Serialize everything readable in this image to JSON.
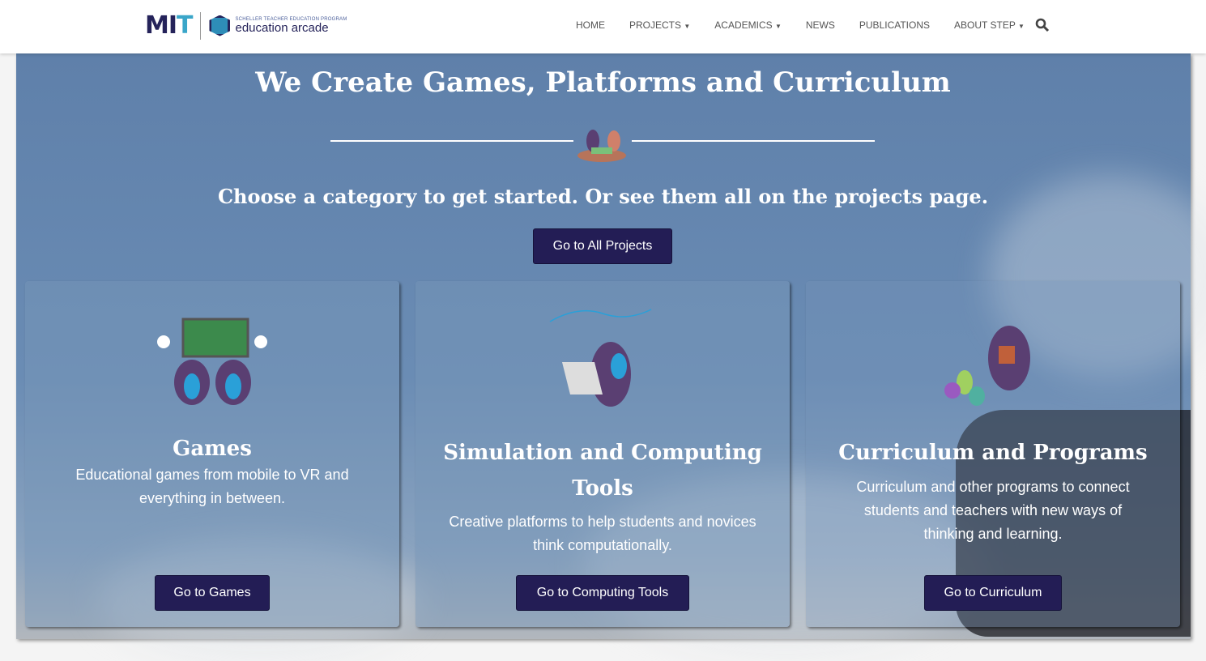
{
  "header": {
    "logo_mit": "MIT",
    "logo_small": "SCHELLER TEACHER EDUCATION PROGRAM",
    "logo_big": "education arcade",
    "nav": [
      {
        "label": "HOME"
      },
      {
        "label": "PROJECTS",
        "dropdown": true
      },
      {
        "label": "ACADEMICS",
        "dropdown": true
      },
      {
        "label": "NEWS"
      },
      {
        "label": "PUBLICATIONS"
      },
      {
        "label": "ABOUT STEP",
        "dropdown": true
      }
    ],
    "search_icon": "search-icon"
  },
  "hero": {
    "title": "We Create Games, Platforms and Curriculum",
    "subtitle": "Choose a category to get started.  Or see them all on the projects page.",
    "button": "Go to All Projects"
  },
  "cards": [
    {
      "title": "Games",
      "text": "Educational games from mobile to VR and everything in between.",
      "button": "Go to Games"
    },
    {
      "title": "Simulation and Computing Tools",
      "text": "Creative platforms to help students and novices think computationally.",
      "button": "Go to Computing Tools"
    },
    {
      "title": "Curriculum and Programs",
      "text": "Curriculum and other programs to connect students and teachers with new ways of thinking and learning.",
      "button": "Go to Curriculum"
    }
  ],
  "colors": {
    "button": "#231d55",
    "hero": "#6686ad"
  }
}
